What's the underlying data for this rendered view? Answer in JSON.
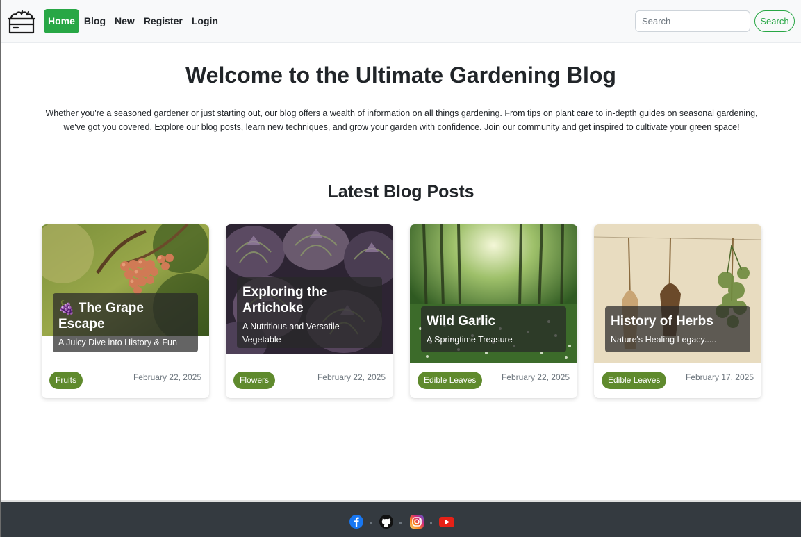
{
  "nav": {
    "brand_icon": "garden-crate-icon",
    "links": [
      {
        "label": "Home",
        "active": true
      },
      {
        "label": "Blog"
      },
      {
        "label": "New"
      },
      {
        "label": "Register"
      },
      {
        "label": "Login"
      }
    ],
    "search_placeholder": "Search",
    "search_button": "Search"
  },
  "hero": {
    "title": "Welcome to the Ultimate Gardening Blog",
    "text": "Whether you're a seasoned gardener or just starting out, our blog offers a wealth of information on all things gardening. From tips on plant care to in-depth guides on seasonal gardening, we've got you covered. Explore our blog posts, learn new techniques, and grow your garden with confidence. Join our community and get inspired to cultivate your green space!"
  },
  "latest": {
    "title": "Latest Blog Posts",
    "posts": [
      {
        "title": "🍇 The Grape Escape",
        "subtitle": "A Juicy Dive into History & Fun Facts",
        "tag": "Fruits",
        "date": "February 22, 2025"
      },
      {
        "title": "Exploring the Artichoke",
        "subtitle": "A Nutritious and Versatile Vegetable",
        "tag": "Flowers",
        "date": "February 22, 2025"
      },
      {
        "title": "Wild Garlic",
        "subtitle": "A Springtime Treasure",
        "tag": "Edible Leaves",
        "date": "February 22, 2025"
      },
      {
        "title": "History of Herbs",
        "subtitle": "Nature's Healing Legacy.....",
        "tag": "Edible Leaves",
        "date": "February 17, 2025"
      }
    ]
  },
  "footer": {
    "icons": [
      "facebook-icon",
      "github-icon",
      "instagram-icon",
      "youtube-icon"
    ]
  },
  "colors": {
    "accent": "#28a745",
    "badge": "#5f8a2d",
    "footer_bg": "#343a40"
  }
}
